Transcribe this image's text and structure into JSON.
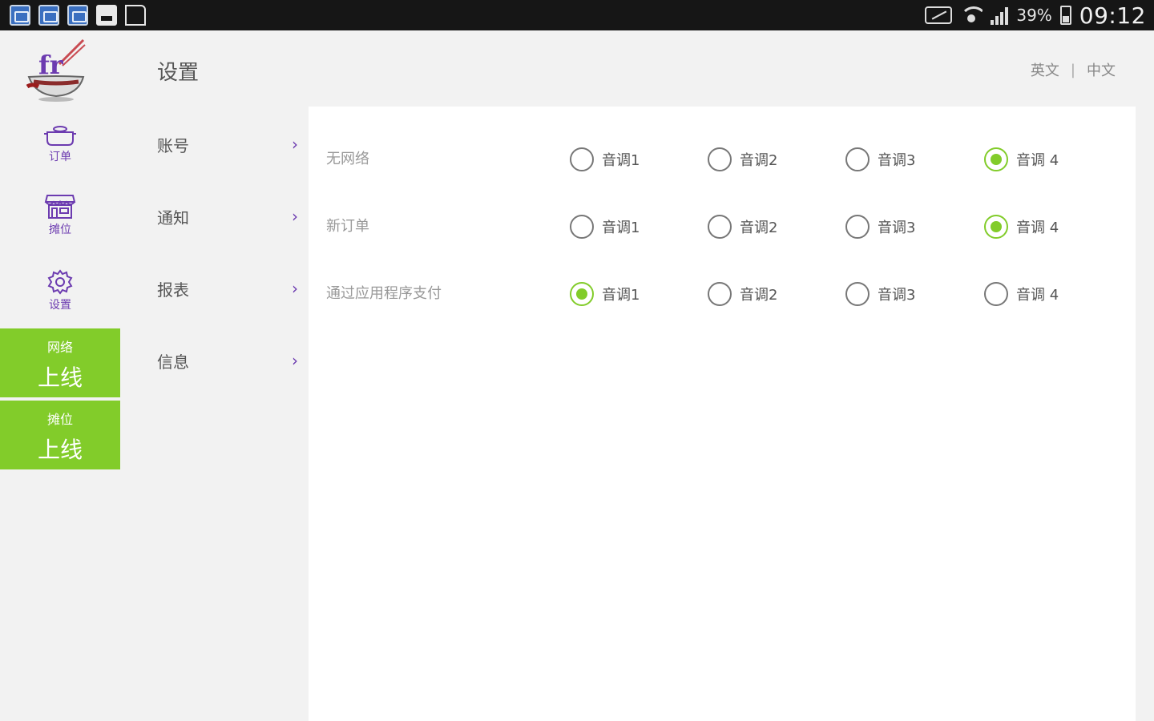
{
  "status_bar": {
    "battery": "39%",
    "time": "09:12"
  },
  "colors": {
    "accent_green": "#82cc2a",
    "accent_purple": "#6c3bb0"
  },
  "rail": {
    "logo_icon": "fr-wok-logo",
    "items": [
      {
        "label": "订单",
        "icon": "pot-icon"
      },
      {
        "label": "摊位",
        "icon": "stall-icon"
      },
      {
        "label": "设置",
        "icon": "gear-icon"
      }
    ],
    "status_blocks": [
      {
        "title": "网络",
        "value": "上线"
      },
      {
        "title": "摊位",
        "value": "上线"
      }
    ]
  },
  "header": {
    "title": "设置",
    "lang_en": "英文",
    "lang_sep": "|",
    "lang_zh": "中文"
  },
  "menu": {
    "items": [
      {
        "label": "账号",
        "chevron": "›"
      },
      {
        "label": "通知",
        "chevron": "›"
      },
      {
        "label": "报表",
        "chevron": "›"
      },
      {
        "label": "信息",
        "chevron": "›"
      }
    ]
  },
  "notifications": {
    "rows": [
      {
        "label": "无网络",
        "options": [
          "音调1",
          "音调2",
          "音调3",
          "音调 4"
        ],
        "selected": 3
      },
      {
        "label": "新订单",
        "options": [
          "音调1",
          "音调2",
          "音调3",
          "音调 4"
        ],
        "selected": 3
      },
      {
        "label": "通过应用程序支付",
        "options": [
          "音调1",
          "音调2",
          "音调3",
          "音调 4"
        ],
        "selected": 0
      }
    ]
  }
}
